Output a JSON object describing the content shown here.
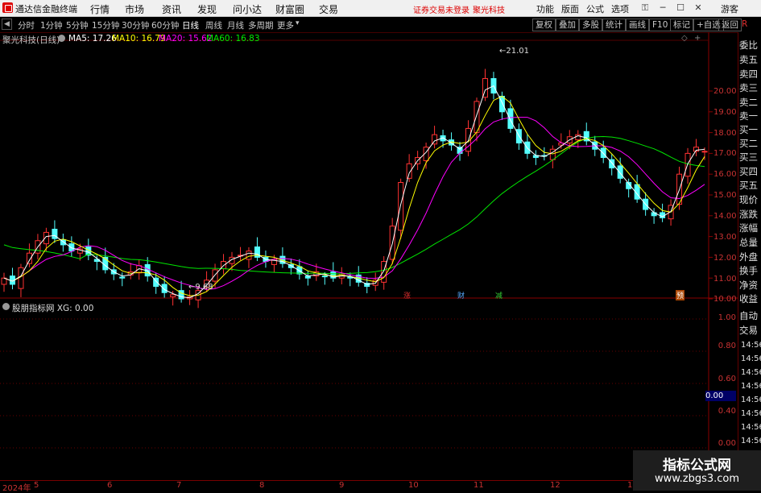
{
  "app": {
    "name": "通达信金融终端"
  },
  "menu": [
    "行情",
    "市场",
    "资讯",
    "发现",
    "问小达",
    "财富圈",
    "交易"
  ],
  "alert": {
    "broker": "证券交易未登录",
    "stock": "聚光科技"
  },
  "right_menu": [
    "功能",
    "版面",
    "公式",
    "选项"
  ],
  "user_label": "游客",
  "periods": [
    "分时",
    "1分钟",
    "5分钟",
    "15分钟",
    "30分钟",
    "60分钟",
    "日线",
    "周线",
    "月线",
    "多周期",
    "更多"
  ],
  "active_period": "日线",
  "tools": [
    "复权",
    "叠加",
    "多股",
    "统计",
    "画线",
    "F10",
    "标记",
    "+自选",
    "返回"
  ],
  "header": {
    "title": "聚光科技(日线)",
    "ma5": "MA5: 17.26",
    "ma10": "MA10: 16.79",
    "ma20": "MA20: 15.62",
    "ma60": "MA60: 16.83"
  },
  "colors": {
    "up": "#ff3232",
    "down": "#54ffff",
    "ma5": "#ffffff",
    "ma10": "#ffff00",
    "ma20": "#ff00ff",
    "ma60": "#00e600"
  },
  "price_ticks": [
    "20.00",
    "19.00",
    "18.00",
    "17.00",
    "16.00",
    "15.00",
    "14.00",
    "13.00",
    "12.00",
    "11.00",
    "10.00"
  ],
  "max_label": "21.01",
  "min_label": "9.68",
  "event_tags": [
    "涨",
    "财",
    "减",
    "预"
  ],
  "indicator": {
    "title": "股朋指标网 XG: 0.00",
    "ticks": [
      "1.00",
      "0.80",
      "0.60",
      "0.40",
      "0.20",
      "0.00"
    ],
    "current": "0.00"
  },
  "right_column": [
    "委比",
    "卖五",
    "卖四",
    "卖三",
    "卖二",
    "卖一",
    "买一",
    "买二",
    "买三",
    "买四",
    "买五",
    "现价",
    "涨跌",
    "涨幅",
    "总量",
    "外盘",
    "换手",
    "净资",
    "收益"
  ],
  "right_column2": [
    "自动",
    "交易"
  ],
  "right_times": [
    "14:56",
    "14:56",
    "14:56",
    "14:56",
    "14:56",
    "14:56",
    "14:56",
    "14:56",
    "14:56",
    "14:56"
  ],
  "right_label": "R",
  "x_axis": {
    "year": "2024年",
    "months": [
      "5",
      "6",
      "7",
      "8",
      "9",
      "10",
      "11",
      "12",
      "1"
    ]
  },
  "watermark": {
    "title": "指标公式网",
    "url": "www.zbgs3.com"
  },
  "chart_data": {
    "type": "candlestick",
    "title": "聚光科技(日线)",
    "ylim": [
      9.5,
      21.3
    ],
    "x_months": [
      "2024-05",
      "2024-06",
      "2024-07",
      "2024-08",
      "2024-09",
      "2024-10",
      "2024-11",
      "2024-12",
      "2025-01"
    ],
    "series": [
      {
        "name": "MA5",
        "value": 17.26
      },
      {
        "name": "MA10",
        "value": 16.79
      },
      {
        "name": "MA20",
        "value": 15.62
      },
      {
        "name": "MA60",
        "value": 16.83
      }
    ],
    "high_marker": 21.01,
    "low_marker": 9.68,
    "close_path": [
      11.0,
      10.7,
      11.5,
      12.2,
      12.8,
      13.2,
      12.9,
      12.6,
      12.3,
      12.4,
      12.1,
      11.8,
      11.4,
      11.2,
      11.0,
      11.3,
      11.6,
      11.1,
      10.6,
      10.3,
      10.2,
      10.0,
      10.1,
      10.4,
      10.9,
      11.4,
      11.8,
      12.0,
      12.1,
      12.3,
      12.0,
      11.8,
      11.9,
      11.7,
      11.5,
      11.2,
      11.0,
      11.3,
      11.1,
      11.0,
      11.2,
      11.0,
      10.8,
      10.6,
      10.9,
      11.8,
      13.5,
      15.6,
      16.5,
      16.8,
      17.3,
      17.9,
      17.6,
      17.4,
      17.0,
      18.2,
      19.5,
      20.6,
      19.9,
      19.0,
      18.2,
      17.5,
      17.0,
      16.8,
      16.9,
      17.2,
      17.5,
      17.8,
      17.9,
      17.6,
      17.2,
      16.8,
      16.3,
      15.8,
      15.3,
      14.8,
      14.3,
      14.0,
      13.9,
      14.5,
      16.0,
      17.0,
      17.3,
      17.1
    ]
  }
}
